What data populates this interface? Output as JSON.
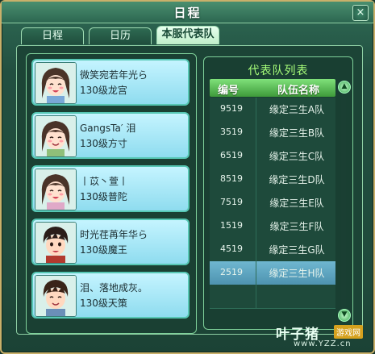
{
  "window": {
    "title": "日程",
    "close_label": "×"
  },
  "tabs": [
    {
      "label": "日程",
      "active": false
    },
    {
      "label": "日历",
      "active": false
    },
    {
      "label": "本服代表队",
      "active": true
    }
  ],
  "members": [
    {
      "name": "微笑宛若年光ら",
      "level": "130级龙宫",
      "avatar": "female-character"
    },
    {
      "name": "GangsTa′ 泪",
      "level": "130级方寸",
      "avatar": "female-character"
    },
    {
      "name": "丨苡丶萱丨",
      "level": "130级普陀",
      "avatar": "female-character"
    },
    {
      "name": "时光荏苒年华ら",
      "level": "130级魔王",
      "avatar": "male-character"
    },
    {
      "name": "泪、落地成灰。",
      "level": "130级天策",
      "avatar": "male-character"
    }
  ],
  "team_list": {
    "title": "代表队列表",
    "columns": [
      "编号",
      "队伍名称"
    ],
    "rows": [
      {
        "id": "9519",
        "name": "缘定三生A队"
      },
      {
        "id": "3519",
        "name": "缘定三生B队"
      },
      {
        "id": "6519",
        "name": "缘定三生C队"
      },
      {
        "id": "8519",
        "name": "缘定三生D队"
      },
      {
        "id": "7519",
        "name": "缘定三生E队"
      },
      {
        "id": "1519",
        "name": "缘定三生F队"
      },
      {
        "id": "4519",
        "name": "缘定三生G队"
      },
      {
        "id": "2519",
        "name": "缘定三生H队"
      },
      {
        "id": "",
        "name": ""
      }
    ],
    "selected_index": 7
  },
  "watermark": {
    "text": "叶子猪",
    "badge": "游戏网",
    "url": "www.YZZ.cn"
  }
}
